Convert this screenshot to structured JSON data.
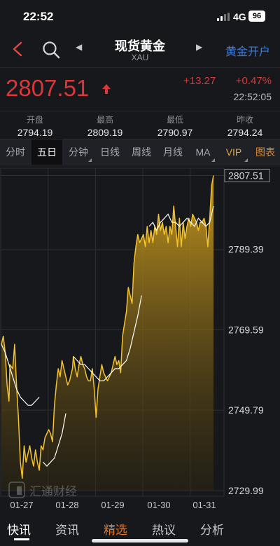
{
  "status_bar": {
    "time": "22:52",
    "network": "4G",
    "battery": "96"
  },
  "header": {
    "title": "现货黄金",
    "subtitle": "XAU",
    "open_account": "黄金开户"
  },
  "quote": {
    "price": "2807.51",
    "change": "+13.27",
    "change_pct": "+0.47%",
    "time": "22:52:05",
    "color_up": "#d8383a"
  },
  "stats": [
    {
      "label": "开盘",
      "value": "2794.19"
    },
    {
      "label": "最高",
      "value": "2809.19"
    },
    {
      "label": "最低",
      "value": "2790.97"
    },
    {
      "label": "昨收",
      "value": "2794.24"
    }
  ],
  "tabs": [
    {
      "label": "分时",
      "active": false
    },
    {
      "label": "五日",
      "active": true
    },
    {
      "label": "分钟",
      "active": false
    },
    {
      "label": "日线",
      "active": false
    },
    {
      "label": "周线",
      "active": false
    },
    {
      "label": "月线",
      "active": false
    },
    {
      "label": "MA",
      "active": false
    },
    {
      "label": "VIP",
      "active": false
    },
    {
      "label": "图表",
      "active": false
    }
  ],
  "chart_data": {
    "type": "line",
    "title": "",
    "y_tick_labels": [
      "2807.51",
      "2789.39",
      "2769.59",
      "2749.79",
      "2729.99"
    ],
    "x_tick_labels": [
      "01-27",
      "01-28",
      "01-29",
      "01-30",
      "01-31"
    ],
    "ylim": [
      2729.99,
      2809.31
    ],
    "last_value": 2807.51,
    "series": [
      {
        "x": [
          0,
          0.04,
          0.08,
          0.12,
          0.16,
          0.18,
          0.24,
          0.28,
          0.32,
          0.36,
          0.4,
          0.44,
          0.48,
          0.52,
          0.56,
          0.6,
          0.64,
          0.68,
          0.72,
          0.76,
          0.8,
          0.84,
          0.88,
          0.92,
          0.96,
          1.0,
          1.04,
          1.08,
          1.12,
          1.16,
          1.2,
          1.24,
          1.28,
          1.32,
          1.36,
          1.4,
          1.44,
          1.48,
          1.5,
          1.52,
          1.56,
          1.6,
          1.64,
          1.68,
          1.72,
          1.76,
          1.8,
          1.84,
          1.88,
          1.92,
          1.96,
          2.0,
          2.04,
          2.08,
          2.12,
          2.16,
          2.2,
          2.24,
          2.28,
          2.32,
          2.36,
          2.4,
          2.44,
          2.48,
          2.52,
          2.56,
          2.6,
          2.64,
          2.68,
          2.72,
          2.76,
          2.8,
          2.84,
          2.88,
          2.92,
          2.96,
          3.0,
          3.04,
          3.08,
          3.12,
          3.16,
          3.2,
          3.24,
          3.28,
          3.32,
          3.36,
          3.4,
          3.44,
          3.48,
          3.52,
          3.56,
          3.6,
          3.64,
          3.68,
          3.72,
          3.76,
          3.8,
          3.84,
          3.88,
          3.92,
          3.96,
          4.0,
          4.04,
          4.08,
          4.12,
          4.16,
          4.2,
          4.24,
          4.28,
          4.32,
          4.36,
          4.4,
          4.44,
          4.48
        ],
        "values": [
          2766,
          2768,
          2764,
          2756,
          2752,
          2761,
          2760,
          2766,
          2756,
          2748,
          2737,
          2733,
          2741,
          2737,
          2739,
          2741,
          2738,
          2736,
          2740,
          2737,
          2735,
          2741,
          2740,
          2743,
          2744,
          2745,
          2744,
          2742,
          2751,
          2756,
          2760,
          2758,
          2762,
          2760,
          2758,
          2756,
          2757,
          2759,
          2760,
          2763,
          2760,
          2758,
          2761,
          2763,
          2761,
          2760,
          2758,
          2757,
          2757,
          2760,
          2755,
          2748,
          2755,
          2758,
          2761,
          2759,
          2758,
          2757,
          2758,
          2759,
          2761,
          2763,
          2761,
          2762,
          2759,
          2768,
          2771,
          2774,
          2780,
          2778,
          2776,
          2786,
          2790,
          2793,
          2791,
          2792,
          2793,
          2790,
          2795,
          2791,
          2794,
          2791,
          2795,
          2793,
          2798,
          2794,
          2796,
          2793,
          2795,
          2791,
          2795,
          2793,
          2800,
          2795,
          2790,
          2797,
          2790,
          2796,
          2792,
          2795,
          2797,
          2795,
          2798,
          2797,
          2796,
          2794,
          2796,
          2796,
          2797,
          2795,
          2790,
          2797,
          2805,
          2807.51
        ]
      },
      {
        "name": "MA",
        "x": [
          0,
          0.08,
          0.16,
          0.24,
          0.32,
          0.4,
          0.48,
          0.56,
          0.64,
          0.72,
          0.8,
          0.84,
          0.88,
          0.96,
          1.04,
          1.12,
          1.2,
          1.28,
          1.36,
          1.44,
          1.52,
          1.6,
          1.68,
          1.76,
          1.84,
          1.92,
          2.0,
          2.08,
          2.16,
          2.24,
          2.32,
          2.4,
          2.48,
          2.56,
          2.64,
          2.72,
          2.8,
          2.88,
          2.96,
          3.04,
          3.12,
          3.2,
          3.28,
          3.36,
          3.44,
          3.52,
          3.6,
          3.68,
          3.76,
          3.84,
          3.92,
          4.0,
          4.08,
          4.16,
          4.24,
          4.32,
          4.4,
          4.48
        ],
        "values": [
          2766,
          2764,
          2761,
          2758,
          2755,
          2753,
          2752,
          2751,
          2751,
          2752,
          2753,
          null,
          2737,
          2736,
          2737,
          2738,
          2741,
          2744,
          2749,
          null,
          2763,
          2762,
          2761,
          2761,
          2760,
          2759,
          2758,
          2757,
          2757,
          2758,
          2759,
          2760,
          2760,
          2761,
          2762,
          2765,
          2769,
          2773,
          2778,
          null,
          2795,
          2796,
          2794,
          2796,
          2797,
          2798,
          2796,
          2796,
          2795,
          2796,
          2797,
          2796,
          2795,
          2797,
          2796,
          2795,
          2796,
          2800
        ]
      }
    ]
  },
  "watermark": "汇通财经",
  "bottom_nav": [
    {
      "label": "快讯",
      "state": "active"
    },
    {
      "label": "资讯",
      "state": "normal"
    },
    {
      "label": "精选",
      "state": "hot"
    },
    {
      "label": "热议",
      "state": "normal"
    },
    {
      "label": "分析",
      "state": "normal"
    }
  ]
}
